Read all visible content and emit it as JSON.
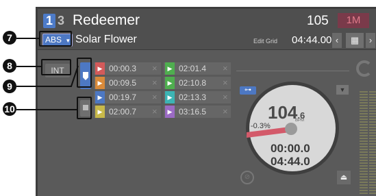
{
  "header": {
    "deck_active": "1",
    "deck_other": "3",
    "track_title": "Redeemer",
    "bpm_display": "105",
    "key_badge": "1M"
  },
  "subheader": {
    "mode_label": "ABS",
    "track_artist": "Solar Flower",
    "edit_grid": "Edit Grid",
    "total_time": "04:44.00",
    "nav_prev": "‹",
    "nav_next": "›"
  },
  "left_controls": {
    "int_label": "INT"
  },
  "hotcues": [
    {
      "color": "#d35a5a",
      "time": "00:00.3"
    },
    {
      "color": "#4fae4f",
      "time": "02:01.4"
    },
    {
      "color": "#d98a3a",
      "time": "00:09.5"
    },
    {
      "color": "#4fae4f",
      "time": "02:10.8"
    },
    {
      "color": "#4d78c3",
      "time": "00:19.7"
    },
    {
      "color": "#3cb4b4",
      "time": "02:13.3"
    },
    {
      "color": "#c8b94a",
      "time": "02:00.7"
    },
    {
      "color": "#9b6bc4",
      "time": "03:16.5"
    }
  ],
  "jog": {
    "bpm_int": "104",
    "bpm_frac": ".6",
    "bpm_unit": "BPM",
    "pitch": "-0.3%",
    "elapsed": "00:00.0",
    "remaining": "04:44.0"
  },
  "callouts": [
    "7",
    "8",
    "9",
    "10"
  ],
  "icons": [
    "bracket-icon",
    "triangle-down-icon",
    "eject-icon",
    "sync-icon",
    "loader-icon"
  ],
  "accent": "#4d78c3"
}
